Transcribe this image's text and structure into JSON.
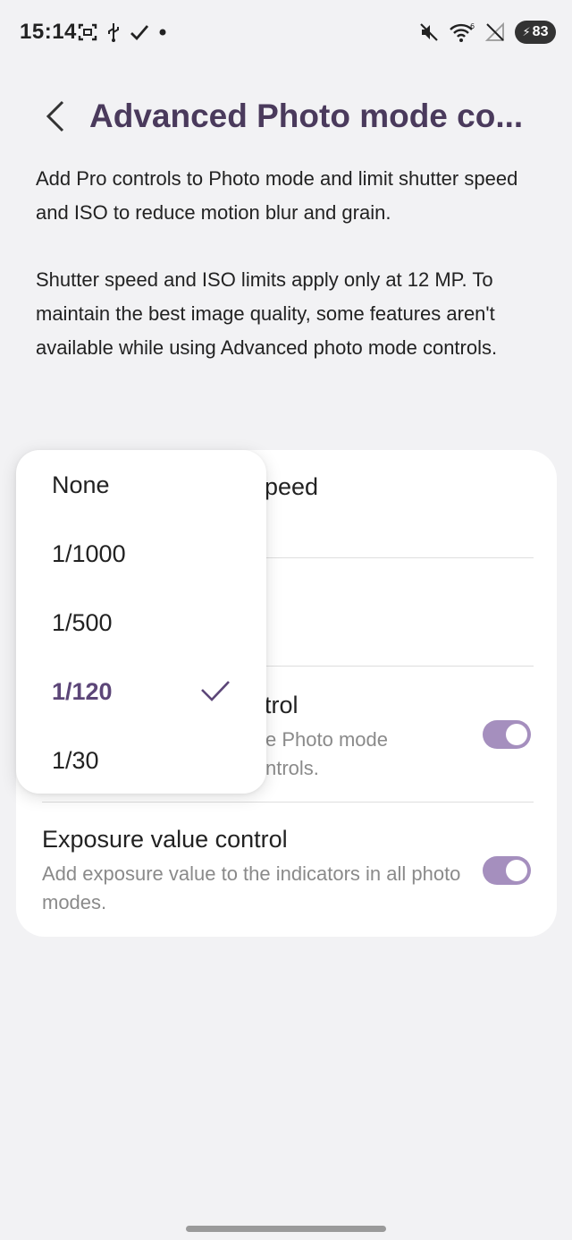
{
  "status_bar": {
    "time": "15:14",
    "battery_level": "83",
    "left_icons": [
      "screenshot-icon",
      "usb-icon",
      "check-icon",
      "dot-icon"
    ],
    "right_icons": [
      "mute-icon",
      "wifi-icon",
      "no-signal-icon",
      "battery-icon"
    ]
  },
  "header": {
    "title": "Advanced Photo mode co..."
  },
  "description": {
    "paragraph_1": "Add Pro controls to Photo mode and limit shutter speed and ISO to reduce motion blur and grain.",
    "paragraph_2": "Shutter speed and ISO limits apply only at 12 MP. To maintain the best image quality, some features aren't available while using Advanced photo mode controls."
  },
  "settings": {
    "row_1_title_partial": "peed",
    "row_3_title_partial": "trol",
    "row_3_sub_line_1": "e Photo mode",
    "row_3_sub_line_2": "ntrols.",
    "row_3_enabled": true,
    "exposure_title": "Exposure value control",
    "exposure_sub": "Add exposure value to the indicators in all photo modes.",
    "exposure_enabled": true
  },
  "dropdown": {
    "options": [
      "None",
      "1/1000",
      "1/500",
      "1/120",
      "1/30"
    ],
    "selected": "1/120"
  },
  "colors": {
    "accent": "#5c4678",
    "title": "#4a3a5c",
    "toggle_on": "#a58fbe",
    "background": "#f2f2f4"
  }
}
